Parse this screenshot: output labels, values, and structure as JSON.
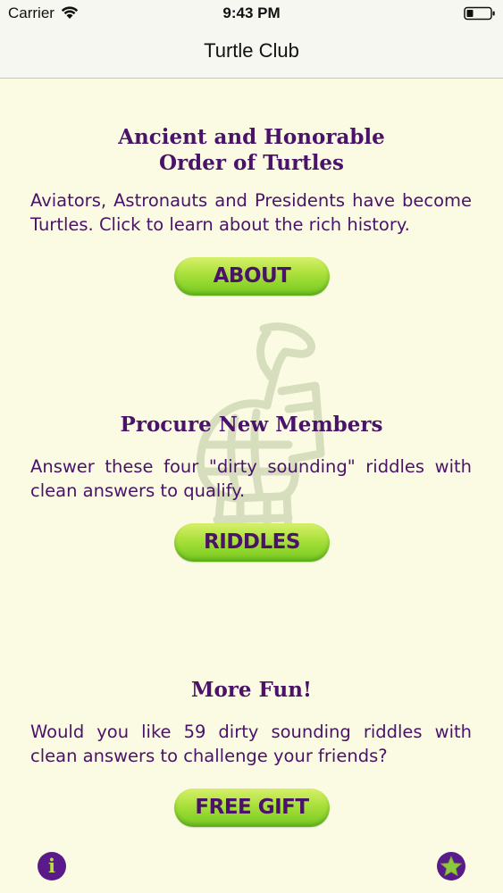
{
  "status_bar": {
    "carrier": "Carrier",
    "time": "9:43 PM",
    "icons": [
      "wifi-icon",
      "battery-icon"
    ]
  },
  "nav": {
    "title": "Turtle Club"
  },
  "sections": [
    {
      "title_line1": "Ancient and Honorable",
      "title_line2": "Order of Turtles",
      "text": "Aviators, Astronauts and Presidents have become Turtles. Click to learn about the rich history.",
      "button_label": "ABOUT"
    },
    {
      "title_line1": "Procure New Members",
      "text": "Answer these four \"dirty sounding\" riddles with clean answers to qualify.",
      "button_label": "RIDDLES"
    },
    {
      "title_line1": "More Fun!",
      "text": "Would you like 59 dirty sounding riddles with clean answers to challenge your friends?",
      "button_label": "FREE GIFT"
    }
  ],
  "footer": {
    "info_glyph": "i",
    "icons": [
      "info-icon",
      "star-icon"
    ]
  },
  "colors": {
    "background": "#fbfbe3",
    "text_purple": "#4a1268",
    "button_green": "#a8e03a",
    "icon_purple": "#5b1a8a",
    "icon_green": "#b9e23c"
  }
}
